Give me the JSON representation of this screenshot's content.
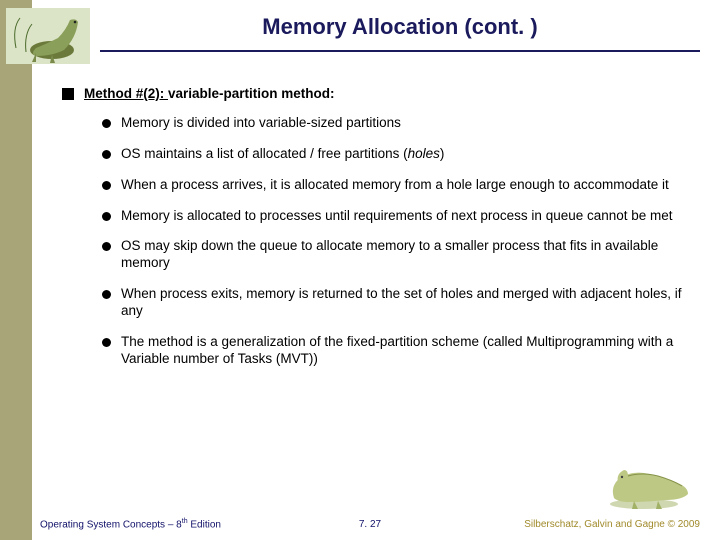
{
  "title": "Memory Allocation (cont. )",
  "heading": {
    "underlined": "Method #(2): ",
    "rest": "variable-partition method:"
  },
  "bullets": [
    {
      "text_a": "Memory is divided into variable-sized partitions"
    },
    {
      "text_a": "OS maintains a list of allocated / free partitions (",
      "hole": "holes",
      "text_b": ")"
    },
    {
      "text_a": "When a process arrives, it is allocated memory from a hole large enough to accommodate it"
    },
    {
      "text_a": "Memory is allocated to processes until requirements of next process in queue cannot be met"
    },
    {
      "text_a": "OS may skip down the queue to allocate memory to a smaller process that fits in available memory"
    },
    {
      "text_a": "When process exits, memory is returned to the set of holes and merged with adjacent holes, if any"
    },
    {
      "text_a": "The method is a generalization of the fixed-partition scheme (called Multiprogramming with a Variable number of Tasks (MVT))"
    }
  ],
  "footer": {
    "left_a": "Operating System Concepts – 8",
    "left_sup": "th",
    "left_b": " Edition",
    "mid": "7. 27",
    "right": "Silberschatz, Galvin and Gagne © 2009"
  }
}
